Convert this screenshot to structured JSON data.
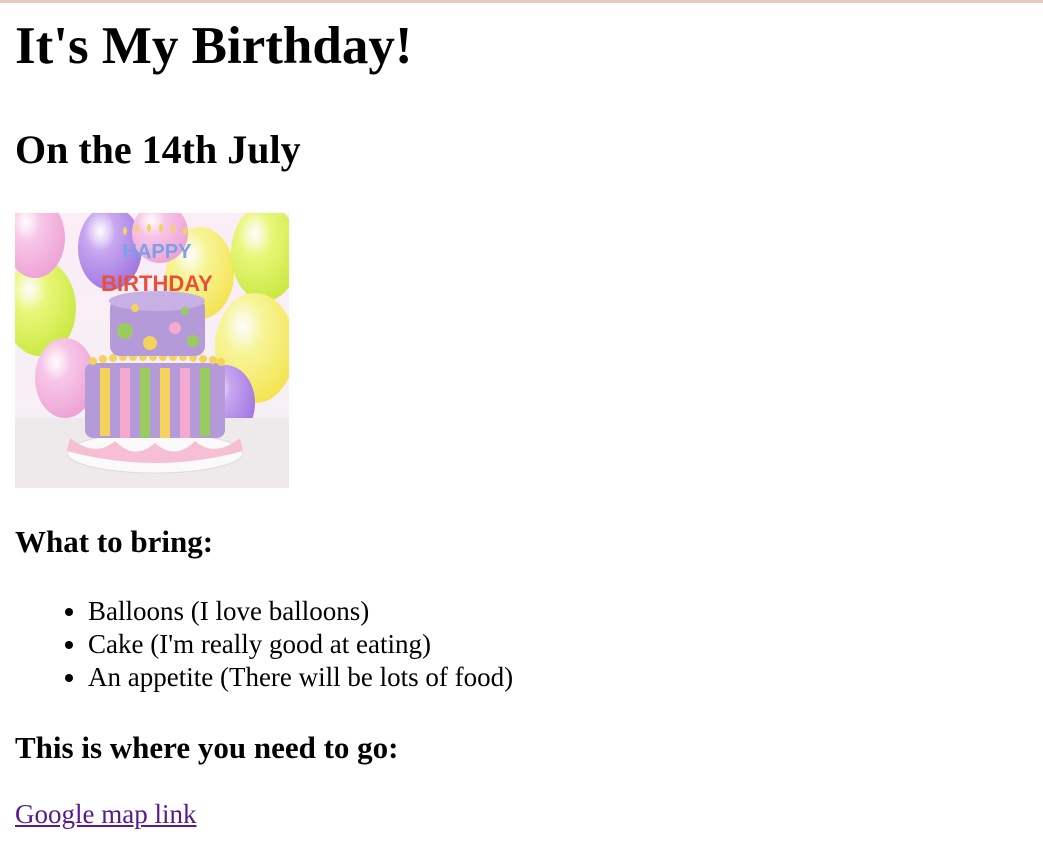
{
  "page": {
    "title": "It's My Birthday!",
    "subtitle": "On the 14th July"
  },
  "image": {
    "icon": "birthday-cake-image",
    "cake_text_top": "HAPPY",
    "cake_text_bottom": "BIRTHDAY",
    "colors": {
      "cake_purple": "#b49ad8",
      "plate_pink": "#f7bfd3",
      "yellow": "#f3d35c",
      "green": "#9acb5e"
    }
  },
  "bring": {
    "heading": "What to bring:",
    "items": [
      "Balloons (I love balloons)",
      "Cake (I'm really good at eating)",
      "An appetite (There will be lots of food)"
    ]
  },
  "location": {
    "heading": "This is where you need to go:",
    "link_text": "Google map link",
    "link_color": "#551a8b"
  }
}
